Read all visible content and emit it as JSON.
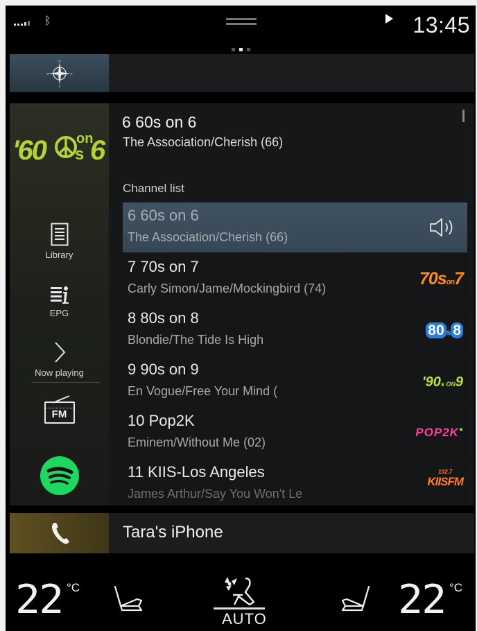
{
  "status_bar": {
    "clock": "13:45"
  },
  "media": {
    "now_playing_title": "6 60s on 6",
    "now_playing_subtitle": "The Association/Cherish (66)",
    "channel_list_header": "Channel list",
    "station_logo": {
      "part1": "'60",
      "part2": "s",
      "part3": "on",
      "part4": "6"
    },
    "side_menu": {
      "library": "Library",
      "epg": "EPG",
      "now_playing": "Now playing",
      "fm": "FM"
    },
    "channels": [
      {
        "title": "6 60s on 6",
        "subtitle": "The Association/Cherish (66)",
        "selected": true,
        "logo": ""
      },
      {
        "title": "7 70s on 7",
        "subtitle": "Carly Simon/Jame/Mockingbird (74)",
        "logo": "70s7"
      },
      {
        "title": "8 80s on 8",
        "subtitle": "Blondie/The Tide Is High",
        "logo": "80s8"
      },
      {
        "title": "9 90s on 9",
        "subtitle": "En Vogue/Free Your Mind (",
        "logo": "90son9"
      },
      {
        "title": "10 Pop2K",
        "subtitle": "Eminem/Without Me (02)",
        "logo": "Pop2K"
      },
      {
        "title": "11 KIIS-Los Angeles",
        "subtitle": "James Arthur/Say You Won't Le",
        "logo": "KIISFM"
      }
    ],
    "logos": {
      "c7": {
        "a": "70s",
        "b": "on",
        "c": "7"
      },
      "c8": {
        "a": "80",
        "b": "s",
        "c": "8"
      },
      "c9": {
        "a": "'90",
        "b": "s ON",
        "c": "9"
      },
      "c10": {
        "a": "POP2K",
        "b": "*"
      },
      "c11": {
        "a": "102.7",
        "b": "KIISFM"
      }
    }
  },
  "phone": {
    "device_name": "Tara's iPhone"
  },
  "climate": {
    "left_temp": "22",
    "right_temp": "22",
    "unit": "°C",
    "fan_mode": "AUTO"
  },
  "colors": {
    "accent_green": "#1ed760",
    "logo_green": "#b5d334",
    "logo_70s": "#ff8a1c",
    "logo_80s": "#3aa6ff",
    "logo_90s": "#b8e045",
    "logo_pop2k": "#ff3fa0",
    "logo_kiis": "#ff7a2a"
  }
}
